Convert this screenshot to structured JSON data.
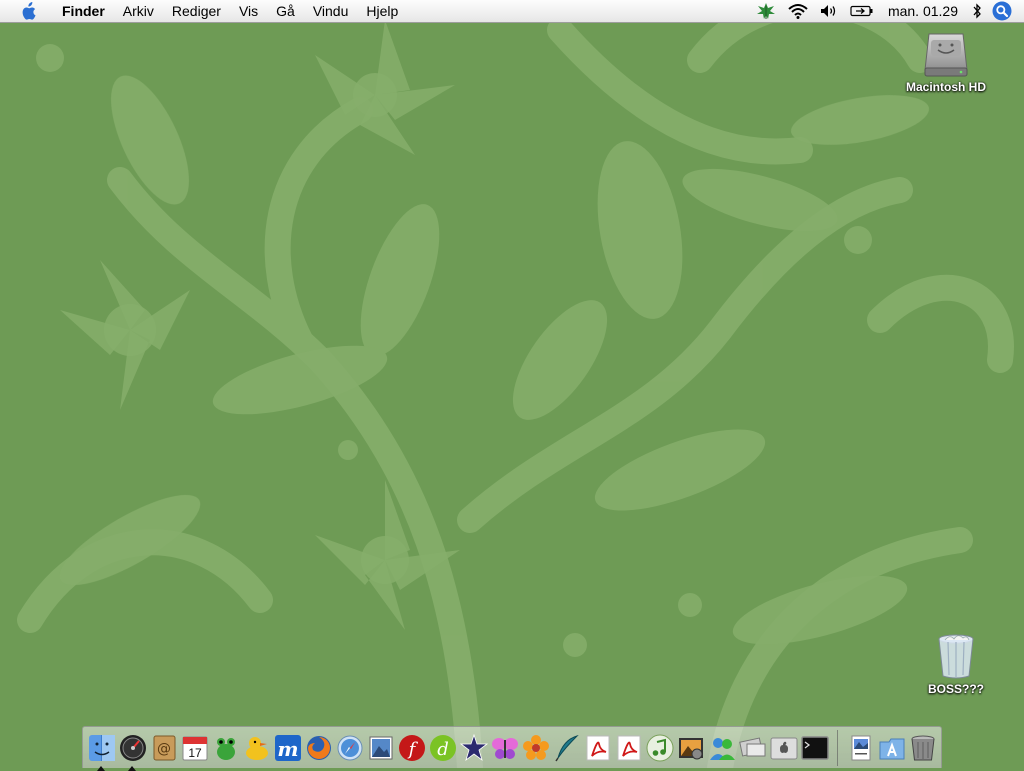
{
  "menubar": {
    "app_name": "Finder",
    "items": [
      "Arkiv",
      "Rediger",
      "Vis",
      "Gå",
      "Vindu",
      "Hjelp"
    ],
    "status_icons": [
      "leaf-icon",
      "wifi-icon",
      "volume-icon",
      "battery-icon",
      "bluetooth-icon",
      "spotlight-icon"
    ],
    "clock": "man. 01.29"
  },
  "desktop": {
    "hd_label": "Macintosh HD",
    "trash_label": "BOSS???"
  },
  "dock": {
    "apps": [
      {
        "icon": "finder-icon",
        "running": true
      },
      {
        "icon": "dashboard-icon",
        "running": true
      },
      {
        "icon": "address-book-icon"
      },
      {
        "icon": "ical-icon",
        "text": "17"
      },
      {
        "icon": "green-frog-icon"
      },
      {
        "icon": "yellow-duck-icon"
      },
      {
        "icon": "m-app-icon",
        "text": "m"
      },
      {
        "icon": "firefox-icon"
      },
      {
        "icon": "safari-icon"
      },
      {
        "icon": "preview-photo-icon"
      },
      {
        "icon": "flash-icon"
      },
      {
        "icon": "dreamweaver-icon"
      },
      {
        "icon": "imovie-star-icon"
      },
      {
        "icon": "butterfly-icon"
      },
      {
        "icon": "flower-icon"
      },
      {
        "icon": "quill-icon"
      },
      {
        "icon": "acrobat-icon"
      },
      {
        "icon": "acrobat-reader-icon"
      },
      {
        "icon": "itunes-icon"
      },
      {
        "icon": "iphoto-icon"
      },
      {
        "icon": "messenger-icon"
      },
      {
        "icon": "migration-icon"
      },
      {
        "icon": "system-prefs-icon"
      },
      {
        "icon": "terminal-icon"
      }
    ],
    "docs": [
      {
        "icon": "document-stack-icon"
      },
      {
        "icon": "applications-folder-icon"
      },
      {
        "icon": "trash-icon"
      }
    ]
  },
  "colors": {
    "wallpaper": "#6e9b55",
    "wallpaper_pattern": "#8bb370",
    "menubar": "#efefef",
    "spotlight": "#2a6fd6"
  }
}
